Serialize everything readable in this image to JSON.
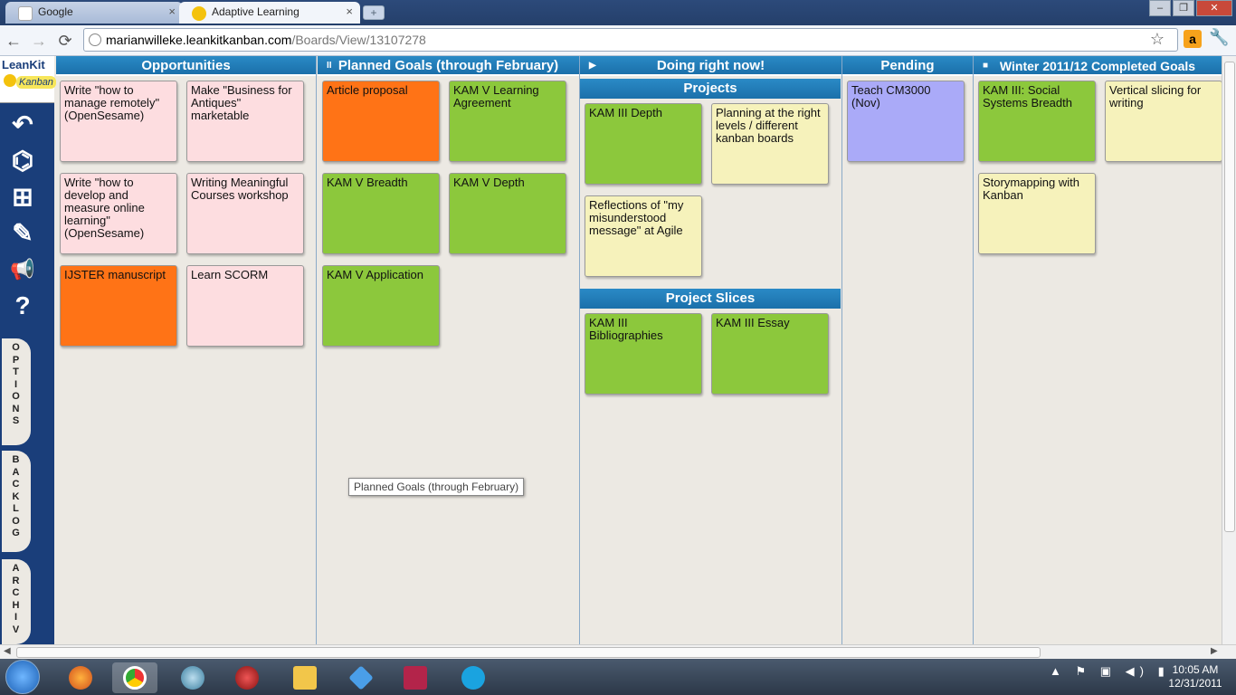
{
  "browser": {
    "tabs": [
      {
        "label": "Google",
        "close": "×"
      },
      {
        "label": "Adaptive Learning",
        "close": "×"
      }
    ],
    "new_tab": "+",
    "window_controls": [
      "–",
      "❐",
      "✕"
    ],
    "url_host": "marianwilleke.leankitkanban.com",
    "url_path": "/Boards/View/13107278",
    "nav": {
      "back": "←",
      "forward": "→",
      "reload": "⟳"
    },
    "star": "☆",
    "amazon": "a",
    "wrench": "🔧"
  },
  "app": {
    "logo_top": "LeanKit",
    "logo_bottom": "Kanban",
    "side_icons": [
      "back-arrow-icon",
      "binoculars-icon",
      "add-icon",
      "edit-icon",
      "megaphone-icon",
      "help-icon"
    ],
    "side_glyphs": [
      "↶",
      "⌬",
      "⊞",
      "✎",
      "📢",
      "?"
    ],
    "vertical_tabs": [
      "OPTIONS",
      "BACKLOG",
      "ARCHIV"
    ]
  },
  "lanes": [
    {
      "title": "Opportunities",
      "icon": "",
      "cards": [
        {
          "text": "Write \"how to manage remotely\" (OpenSesame)",
          "color": "pink"
        },
        {
          "text": "Make \"Business for Antiques\" marketable",
          "color": "pink"
        },
        {
          "text": "Write \"how to develop and measure online learning\" (OpenSesame)",
          "color": "pink"
        },
        {
          "text": "Writing Meaningful Courses workshop",
          "color": "pink"
        },
        {
          "text": "IJSTER manuscript",
          "color": "orange"
        },
        {
          "text": "Learn SCORM",
          "color": "pink"
        }
      ]
    },
    {
      "title": "Planned Goals (through February)",
      "icon": "II",
      "cards": [
        {
          "text": "Article proposal",
          "color": "orange"
        },
        {
          "text": "KAM V Learning Agreement",
          "color": "green"
        },
        {
          "text": "KAM V Breadth",
          "color": "green"
        },
        {
          "text": "KAM V Depth",
          "color": "green"
        },
        {
          "text": "KAM V Application",
          "color": "green"
        }
      ]
    },
    {
      "title": "Doing right now!",
      "icon": "▶",
      "sublanes": [
        {
          "title": "Projects",
          "cards": [
            {
              "text": "KAM III Depth",
              "color": "green"
            },
            {
              "text": "Planning at the right levels / different kanban boards",
              "color": "yellow"
            },
            {
              "text": "Reflections of \"my misunderstood message\" at Agile",
              "color": "yellow"
            }
          ]
        },
        {
          "title": "Project Slices",
          "cards": [
            {
              "text": "KAM III Bibliographies",
              "color": "green"
            },
            {
              "text": "KAM III Essay",
              "color": "green"
            }
          ]
        }
      ]
    },
    {
      "title": "Pending",
      "icon": "",
      "cards": [
        {
          "text": "Teach CM3000 (Nov)",
          "color": "lav"
        }
      ]
    },
    {
      "title": "Winter 2011/12 Completed Goals",
      "icon": "■",
      "cards": [
        {
          "text": "KAM III: Social Systems Breadth",
          "color": "green"
        },
        {
          "text": "Vertical slicing for writing",
          "color": "yellow"
        },
        {
          "text": "Storymapping with Kanban",
          "color": "yellow"
        }
      ]
    }
  ],
  "tooltip": "Planned Goals (through February)",
  "scroll": {
    "left": "◀",
    "right": "▶",
    "grip": "|||"
  },
  "taskbar": {
    "apps": [
      "firefox-icon",
      "chrome-icon",
      "globe-app-icon",
      "red-swirl-app-icon",
      "folder-bird-app-icon",
      "dropbox-icon",
      "access-icon",
      "skype-icon"
    ],
    "tray": "▲ ⚑ ▣ ◀) ▮",
    "time": "10:05 AM",
    "date": "12/31/2011"
  }
}
